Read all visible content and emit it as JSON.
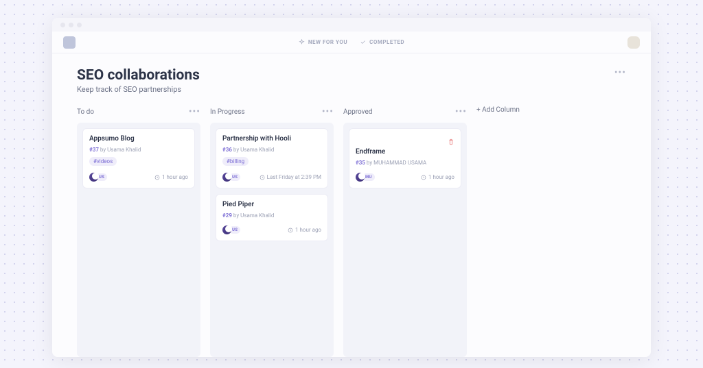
{
  "top": {
    "new_label": "NEW FOR YOU",
    "completed_label": "COMPLETED"
  },
  "board": {
    "title": "SEO collaborations",
    "subtitle": "Keep track of SEO partnerships",
    "add_column_label": "+ Add Column",
    "columns": [
      {
        "name": "To do",
        "cards": [
          {
            "title": "Appsumo Blog",
            "issue": "#37",
            "by_label": "by",
            "author": "Usama Khalid",
            "tag": "#videos",
            "avatar_initials": "US",
            "timestamp": "1 hour ago",
            "dismissable": false
          }
        ]
      },
      {
        "name": "In Progress",
        "cards": [
          {
            "title": "Partnership with Hooli",
            "issue": "#36",
            "by_label": "by",
            "author": "Usama Khalid",
            "tag": "#billing",
            "avatar_initials": "US",
            "timestamp": "Last Friday at 2:39 PM",
            "dismissable": false
          },
          {
            "title": "Pied Piper",
            "issue": "#29",
            "by_label": "by",
            "author": "Usama Khalid",
            "tag": null,
            "avatar_initials": "US",
            "timestamp": "1 hour ago",
            "dismissable": false
          }
        ]
      },
      {
        "name": "Approved",
        "cards": [
          {
            "title": "Endframe",
            "issue": "#35",
            "by_label": "by",
            "author": "MUHAMMAD USAMA",
            "tag": null,
            "avatar_initials": "MU",
            "timestamp": "1 hour ago",
            "dismissable": true
          }
        ]
      }
    ]
  }
}
